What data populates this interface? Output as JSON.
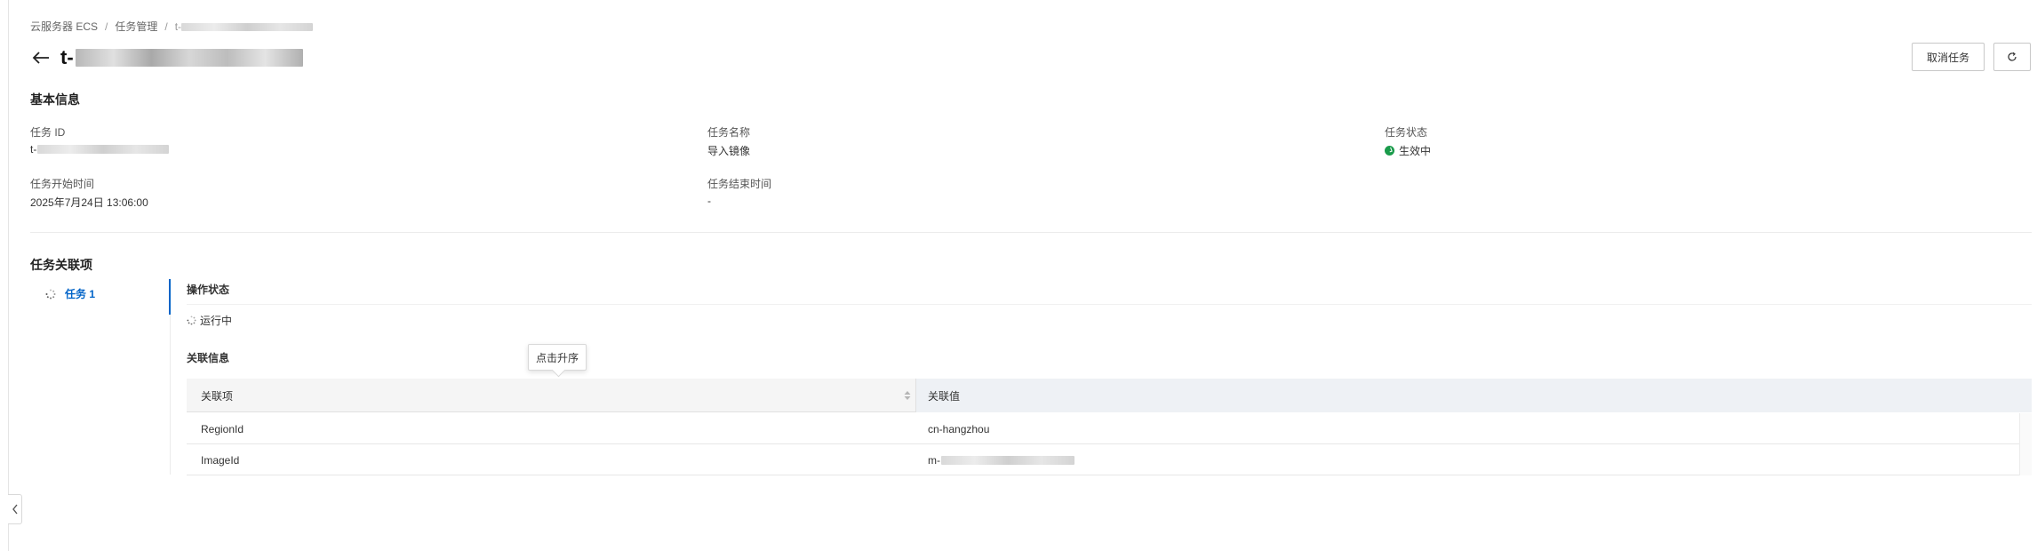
{
  "breadcrumb": {
    "items": [
      "云服务器 ECS",
      "任务管理"
    ],
    "current_prefix": "t-"
  },
  "header": {
    "title_prefix": "t-",
    "cancel_label": "取消任务",
    "refresh_icon": "refresh-icon",
    "back_icon": "arrow-left-icon"
  },
  "basic_info": {
    "section_title": "基本信息",
    "task_id_label": "任务 ID",
    "task_id_prefix": "t-",
    "task_name_label": "任务名称",
    "task_name_value": "导入镜像",
    "task_status_label": "任务状态",
    "task_status_value": "生效中",
    "start_time_label": "任务开始时间",
    "start_time_value": "2025年7月24日 13:06:00",
    "end_time_label": "任务结束时间",
    "end_time_value": "-"
  },
  "related": {
    "section_title": "任务关联项",
    "tasks": [
      {
        "label": "任务 1"
      }
    ],
    "op_status_label": "操作状态",
    "op_status_value": "运行中",
    "rel_info_label": "关联信息",
    "tooltip": "点击升序",
    "columns": [
      "关联项",
      "关联值"
    ],
    "rows": [
      {
        "key": "RegionId",
        "value": "cn-hangzhou"
      },
      {
        "key": "ImageId",
        "value_prefix": "m-"
      }
    ]
  },
  "colors": {
    "accent": "#0064c8",
    "status_green": "#1a9b4b"
  }
}
